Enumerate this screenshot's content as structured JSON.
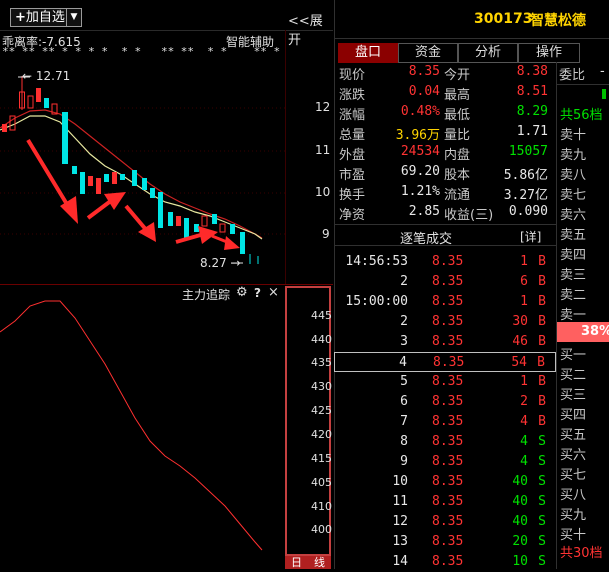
{
  "toolbar": {
    "add_label": "加自选",
    "plus": "+",
    "drop": "▼",
    "expand_label": "<<展开"
  },
  "chart": {
    "deviation_label": "乖离率:",
    "deviation_value": "-7.615",
    "assist_label": "智能辅助",
    "star_row": "** ** ** * * * *  * *   ** **  * *    ** *",
    "high_label": "12.71",
    "low_label": "8.27",
    "price_axis": [
      "12",
      "11",
      "10",
      "9"
    ],
    "subchart_title": "主力追踪",
    "gear": "⚙",
    "question": "?",
    "close": "×",
    "sub_axis": [
      "445",
      "440",
      "435",
      "430",
      "425",
      "420",
      "415",
      "410",
      "405",
      "400"
    ],
    "day_tab": "日",
    "line_tab": "线"
  },
  "stock": {
    "code": "300173",
    "name": "智慧松德"
  },
  "tabs": [
    "盘口",
    "资金",
    "分析",
    "操作"
  ],
  "quote": {
    "left": [
      {
        "label": "现价",
        "value": "8.35",
        "color": "red"
      },
      {
        "label": "涨跌",
        "value": "0.04",
        "color": "red"
      },
      {
        "label": "涨幅",
        "value": "0.48%",
        "color": "red"
      },
      {
        "label": "总量",
        "value": "3.96万",
        "color": "yellow"
      },
      {
        "label": "外盘",
        "value": "24534",
        "color": "red"
      },
      {
        "label": "市盈",
        "value": "69.20",
        "color": "white"
      },
      {
        "label": "换手",
        "value": "1.21%",
        "color": "white"
      },
      {
        "label": "净资",
        "value": "2.85",
        "color": "white"
      }
    ],
    "right": [
      {
        "label": "今开",
        "value": "8.38",
        "color": "red"
      },
      {
        "label": "最高",
        "value": "8.51",
        "color": "red"
      },
      {
        "label": "最低",
        "value": "8.29",
        "color": "green"
      },
      {
        "label": "量比",
        "value": "1.71",
        "color": "white"
      },
      {
        "label": "内盘",
        "value": "15057",
        "color": "green"
      },
      {
        "label": "股本",
        "value": "5.86亿",
        "color": "white"
      },
      {
        "label": "流通",
        "value": "3.27亿",
        "color": "white"
      },
      {
        "label": "收益(三)",
        "value": "0.090",
        "color": "white"
      }
    ]
  },
  "trades_header": {
    "title": "逐笔成交",
    "detail": "[详]"
  },
  "trades": [
    {
      "time": "14:56:53",
      "price": "8.35",
      "vol": "1",
      "side": "B"
    },
    {
      "time": "2",
      "price": "8.35",
      "vol": "6",
      "side": "B"
    },
    {
      "time": "15:00:00",
      "price": "8.35",
      "vol": "1",
      "side": "B"
    },
    {
      "time": "2",
      "price": "8.35",
      "vol": "30",
      "side": "B"
    },
    {
      "time": "3",
      "price": "8.35",
      "vol": "46",
      "side": "B"
    },
    {
      "time": "4",
      "price": "8.35",
      "vol": "54",
      "side": "B"
    },
    {
      "time": "5",
      "price": "8.35",
      "vol": "1",
      "side": "B"
    },
    {
      "time": "6",
      "price": "8.35",
      "vol": "2",
      "side": "B"
    },
    {
      "time": "7",
      "price": "8.35",
      "vol": "4",
      "side": "B"
    },
    {
      "time": "8",
      "price": "8.35",
      "vol": "4",
      "side": "S"
    },
    {
      "time": "9",
      "price": "8.35",
      "vol": "4",
      "side": "S"
    },
    {
      "time": "10",
      "price": "8.35",
      "vol": "40",
      "side": "S"
    },
    {
      "time": "11",
      "price": "8.35",
      "vol": "40",
      "side": "S"
    },
    {
      "time": "12",
      "price": "8.35",
      "vol": "40",
      "side": "S"
    },
    {
      "time": "13",
      "price": "8.35",
      "vol": "20",
      "side": "S"
    },
    {
      "time": "14",
      "price": "8.35",
      "vol": "10",
      "side": "S"
    }
  ],
  "orderbook": {
    "ratio_label": "委比",
    "ratio_value": "-",
    "sell_total": "共56档",
    "sells": [
      "卖十",
      "卖九",
      "卖八",
      "卖七",
      "卖六",
      "卖五",
      "卖四",
      "卖三",
      "卖二",
      "卖一"
    ],
    "mid": "38%",
    "buys": [
      "买一",
      "买二",
      "买三",
      "买四",
      "买五",
      "买六",
      "买七",
      "买八",
      "买九",
      "买十"
    ],
    "buy_total": "共30档"
  }
}
